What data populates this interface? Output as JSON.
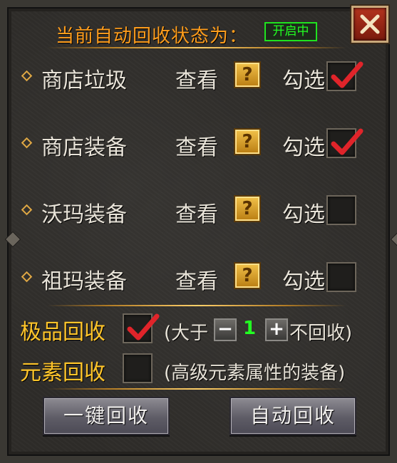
{
  "header": {
    "title": "当前自动回收状态为：",
    "status": "开启中"
  },
  "categories": [
    {
      "label": "商店垃圾",
      "view": "查看",
      "help": "?",
      "select": "勾选",
      "checked": true
    },
    {
      "label": "商店装备",
      "view": "查看",
      "help": "?",
      "select": "勾选",
      "checked": true
    },
    {
      "label": "沃玛装备",
      "view": "查看",
      "help": "?",
      "select": "勾选",
      "checked": false
    },
    {
      "label": "祖玛装备",
      "view": "查看",
      "help": "?",
      "select": "勾选",
      "checked": false
    }
  ],
  "premium": {
    "label": "极品回收",
    "checked": true,
    "prefix": "(大于",
    "minus": "−",
    "value": "1",
    "plus": "+",
    "suffix": "不回收)"
  },
  "element": {
    "label": "元素回收",
    "checked": false,
    "desc": "(高级元素属性的装备)"
  },
  "buttons": {
    "one_click": "一键回收",
    "auto": "自动回收"
  },
  "colors": {
    "title": "#ff9d1c",
    "status": "#22ff22",
    "option": "#ffc52a",
    "check": "#e0242a"
  }
}
